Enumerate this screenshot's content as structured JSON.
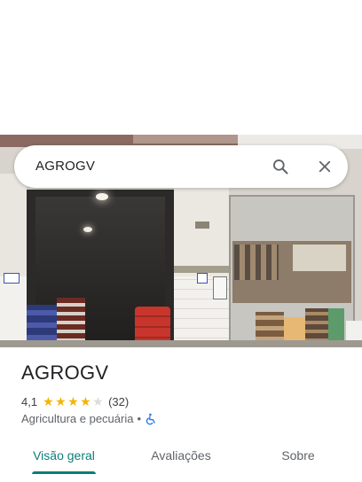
{
  "search": {
    "query": "AGROGV",
    "icons": [
      "search-icon",
      "close-icon"
    ]
  },
  "place": {
    "name": "AGROGV",
    "rating": "4,1",
    "stars": 4.1,
    "review_count": "(32)",
    "category": "Agricultura e pecuária",
    "separator": "•",
    "accessibility_icon": "wheelchair-icon"
  },
  "tabs": [
    {
      "label": "Visão geral",
      "active": true
    },
    {
      "label": "Avaliações",
      "active": false
    },
    {
      "label": "Sobre",
      "active": false
    }
  ],
  "colors": {
    "accent": "#0b7e77",
    "star": "#f5b400",
    "accessibility": "#1a73e8"
  }
}
